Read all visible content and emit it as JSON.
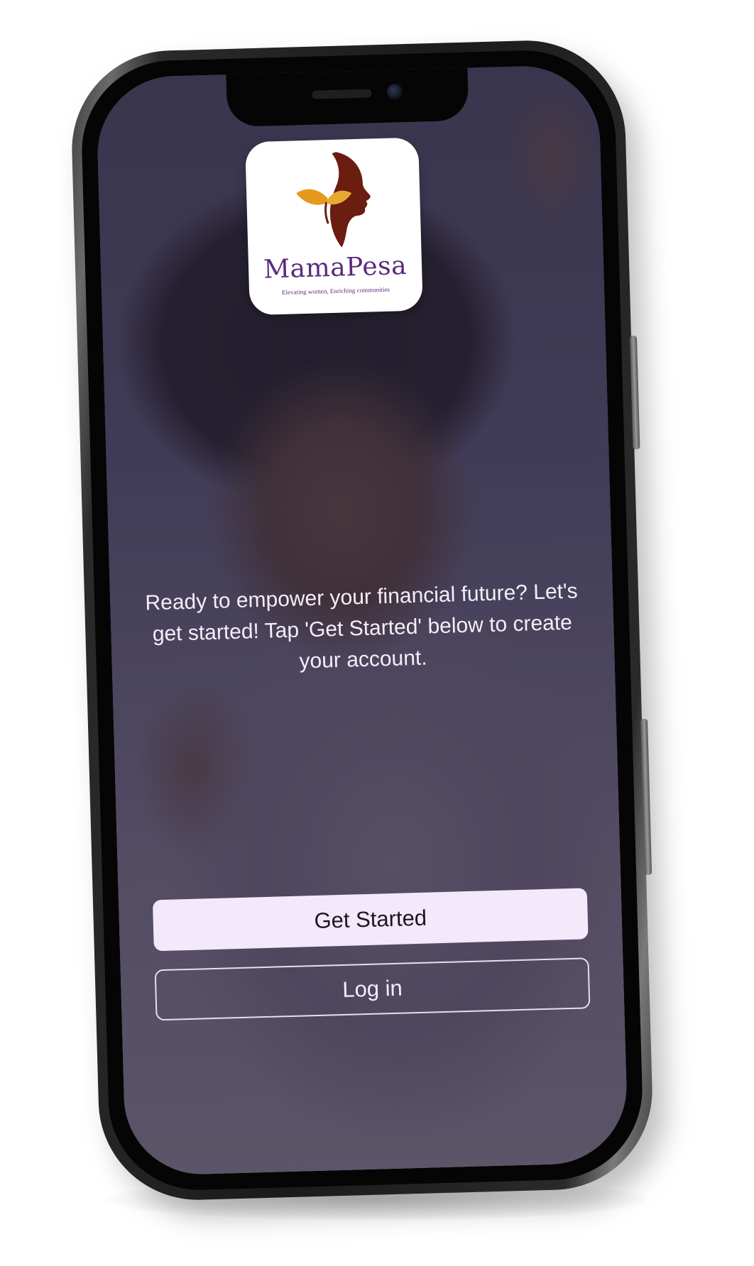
{
  "app": {
    "name": "MamaPesa",
    "tagline": "Elevating women, Enriching communities"
  },
  "onboarding": {
    "message": "Ready to empower your financial future? Let's get started! Tap 'Get Started' below to create your account.",
    "primary_button": "Get Started",
    "secondary_button": "Log in"
  },
  "icons": {
    "logo": "woman-profile-with-leaves-logo"
  },
  "colors": {
    "brand_purple": "#5a2b7e",
    "logo_brown": "#6b1d0f",
    "logo_orange": "#e59a1e",
    "primary_button_bg": "#f4e8fb",
    "overlay": "#262034"
  }
}
